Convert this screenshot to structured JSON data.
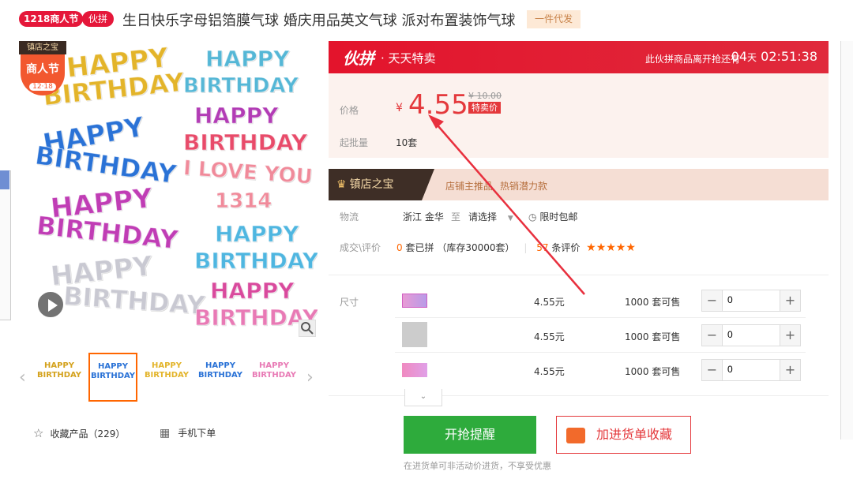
{
  "header": {
    "tag_1218": "1218商人节",
    "tag_huopin": "伙拼",
    "title": "生日快乐字母铝箔膜气球 婚庆用品英文气球 派对布置装饰气球",
    "dropship": "一件代发"
  },
  "gallery": {
    "badge_top": "镇店之宝",
    "badge_main": "商人节",
    "badge_date": "12·18",
    "main_image_text": [
      "HAPPY",
      "BIRTHDAY",
      "HAPPY",
      "BIRTHDAY",
      "HAPPY",
      "BIRTHDAY",
      "HAPPY",
      "BIRTHDAY",
      "HAPPY",
      "BIRTHDAY",
      "HAPPY",
      "BIRTHDAY",
      "I LOVE YOU",
      "1314",
      "HAPPY",
      "BIRTHDAY",
      "HAPPY",
      "BIRTHDAY"
    ],
    "thumbs": [
      "HAPPY BIRTHDAY",
      "HAPPY BIRTHDAY",
      "HAPPY BIRTHDAY",
      "HAPPY BIRTHDAY",
      "HAPPY BIRTHDAY"
    ],
    "active_thumb": 1
  },
  "actions": {
    "favorite": "收藏产品（229）",
    "mobile": "手机下单"
  },
  "promo": {
    "logo": "伙拼",
    "name": "· 天天特卖",
    "countdown_label": "此伙拼商品离开抢还有",
    "days": "04",
    "days_unit": "天",
    "time": "02:51:38"
  },
  "price": {
    "label": "价格",
    "currency": "¥",
    "value": "4.55",
    "old": "¥ 10.00",
    "sale_tag": "特卖价",
    "moq_label": "起批量",
    "moq_value": "10套"
  },
  "store": {
    "tag": "镇店之宝",
    "recommend": "店铺主推品",
    "hot": "热销潜力款"
  },
  "logistics": {
    "label": "物流",
    "from": "浙江 金华",
    "to_sep": "至",
    "to": "请选择",
    "free_ship": "限时包邮"
  },
  "deals": {
    "label": "成交\\评价",
    "sold_count": "0",
    "sold_text": "套已拼",
    "stock": "（库存30000套）",
    "review_count": "57",
    "review_text": "条评价",
    "stars": "★★★★★"
  },
  "sku": {
    "label": "尺寸",
    "rows": [
      {
        "price": "4.55元",
        "stock": "1000 套可售",
        "qty": "0"
      },
      {
        "price": "4.55元",
        "stock": "1000 套可售",
        "qty": "0"
      },
      {
        "price": "4.55元",
        "stock": "1000 套可售",
        "qty": "0"
      }
    ]
  },
  "buttons": {
    "remind": "开抢提醒",
    "collect": "加进货单收藏",
    "note": "在进货单可非活动价进货，不享受优惠"
  },
  "colors": {
    "brand_red": "#e4393c",
    "green": "#2eab3c",
    "annotation_arrow": "#e8303e"
  }
}
